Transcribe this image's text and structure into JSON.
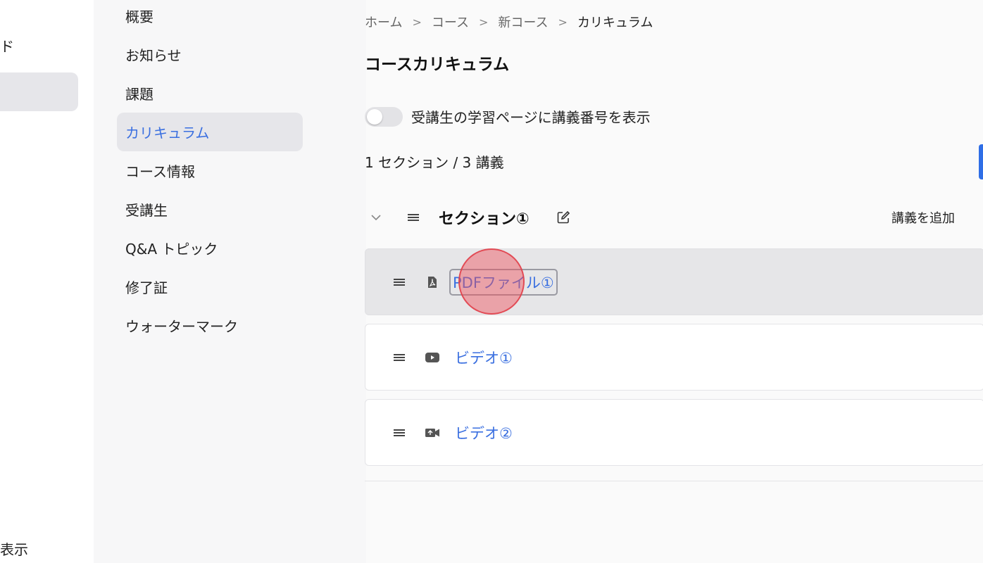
{
  "left_rail": {
    "top_text": "ド",
    "bottom_text": "表示"
  },
  "sub_nav": {
    "items": [
      {
        "label": "概要"
      },
      {
        "label": "お知らせ"
      },
      {
        "label": "課題"
      },
      {
        "label": "カリキュラム",
        "active": true
      },
      {
        "label": "コース情報"
      },
      {
        "label": "受講生"
      },
      {
        "label": "Q&A トピック"
      },
      {
        "label": "修了証"
      },
      {
        "label": "ウォーターマーク"
      }
    ]
  },
  "breadcrumb": [
    "ホーム",
    "コース",
    "新コース",
    "カリキュラム"
  ],
  "breadcrumb_separator": ">",
  "page_title": "コースカリキュラム",
  "toggle": {
    "label": "受講生の学習ページに講義番号を表示",
    "on": false
  },
  "summary": "1 セクション / 3 講義",
  "section": {
    "title": "セクション①",
    "add_lecture_label": "講義を追加"
  },
  "lectures": [
    {
      "title": "PDFファイル①",
      "icon": "pdf-icon",
      "selected": true
    },
    {
      "title": "ビデオ①",
      "icon": "youtube-icon",
      "selected": false
    },
    {
      "title": "ビデオ②",
      "icon": "video-camera-icon",
      "selected": false
    }
  ],
  "colors": {
    "accent": "#3a6fe0",
    "nav_active_bg": "#e6e6ea",
    "click_marker": "#f0505a"
  }
}
